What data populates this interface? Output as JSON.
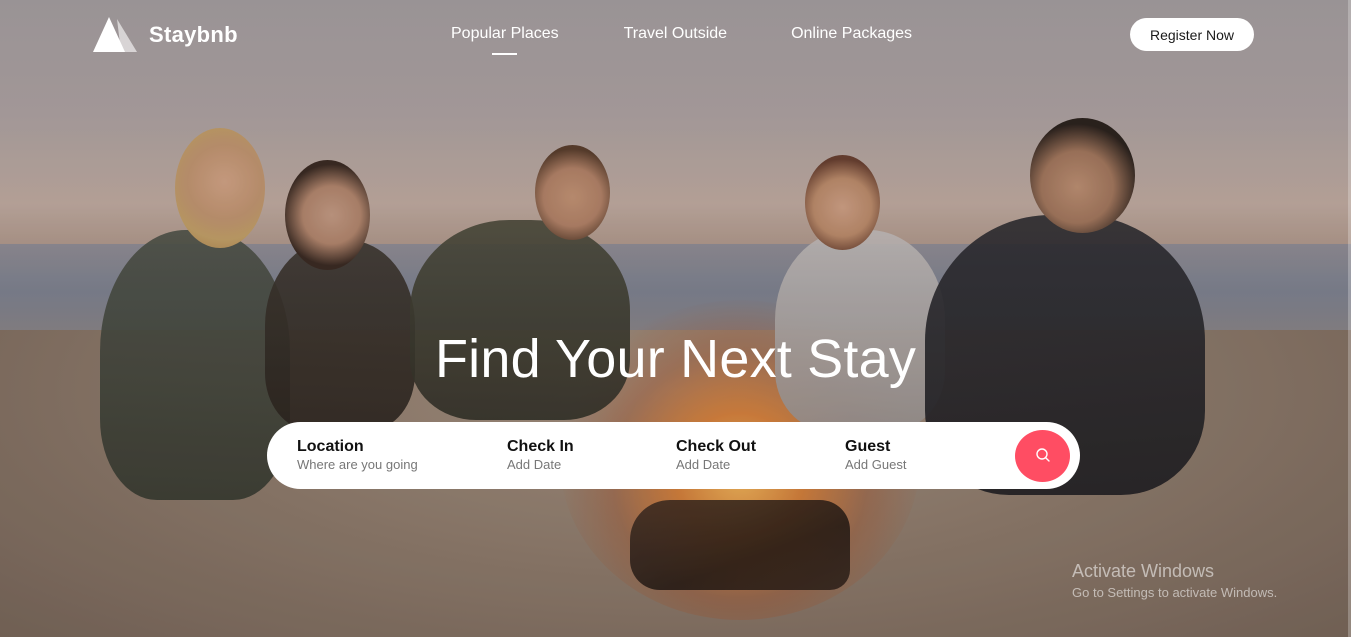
{
  "brand": {
    "name": "Staybnb",
    "logo_icon": "triangle-mountain-icon"
  },
  "nav": {
    "links": [
      {
        "label": "Popular Places",
        "active": true
      },
      {
        "label": "Travel Outside",
        "active": false
      },
      {
        "label": "Online Packages",
        "active": false
      }
    ],
    "register_label": "Register Now"
  },
  "hero": {
    "headline": "Find Your Next Stay"
  },
  "search": {
    "fields": [
      {
        "label": "Location",
        "hint": "Where are you going"
      },
      {
        "label": "Check In",
        "hint": "Add Date"
      },
      {
        "label": "Check Out",
        "hint": "Add Date"
      },
      {
        "label": "Guest",
        "hint": "Add Guest"
      }
    ],
    "button_icon": "search-icon"
  },
  "watermark": {
    "title": "Activate Windows",
    "subtitle": "Go to Settings to activate Windows."
  },
  "colors": {
    "accent": "#ff4d63",
    "text_light": "#ffffff"
  }
}
